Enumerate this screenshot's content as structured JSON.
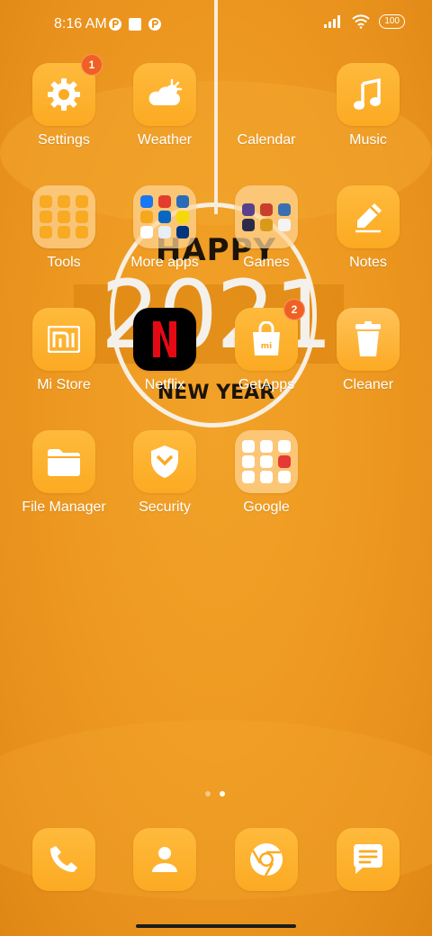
{
  "status_bar": {
    "time": "8:16 AM",
    "battery": "100"
  },
  "wallpaper": {
    "happy": "HAPPY",
    "year": "2021",
    "new_year": "NEW YEAR"
  },
  "apps": {
    "settings": {
      "label": "Settings",
      "badge": "1"
    },
    "weather": {
      "label": "Weather"
    },
    "calendar": {
      "label": "Calendar"
    },
    "music": {
      "label": "Music"
    },
    "tools": {
      "label": "Tools"
    },
    "more_apps": {
      "label": "More apps"
    },
    "games": {
      "label": "Games"
    },
    "notes": {
      "label": "Notes"
    },
    "mi_store": {
      "label": "Mi Store"
    },
    "netflix": {
      "label": "Netflix"
    },
    "getapps": {
      "label": "GetApps",
      "badge": "2"
    },
    "cleaner": {
      "label": "Cleaner"
    },
    "file_manager": {
      "label": "File Manager"
    },
    "security": {
      "label": "Security"
    },
    "google": {
      "label": "Google"
    }
  },
  "page_indicator": {
    "pages": 2,
    "current": 2
  },
  "dock": [
    "phone-icon",
    "contacts-icon",
    "chrome-icon",
    "messages-icon"
  ],
  "colors": {
    "accent": "#fbaa22",
    "background": "#ee9a22",
    "badge": "#f06023"
  }
}
